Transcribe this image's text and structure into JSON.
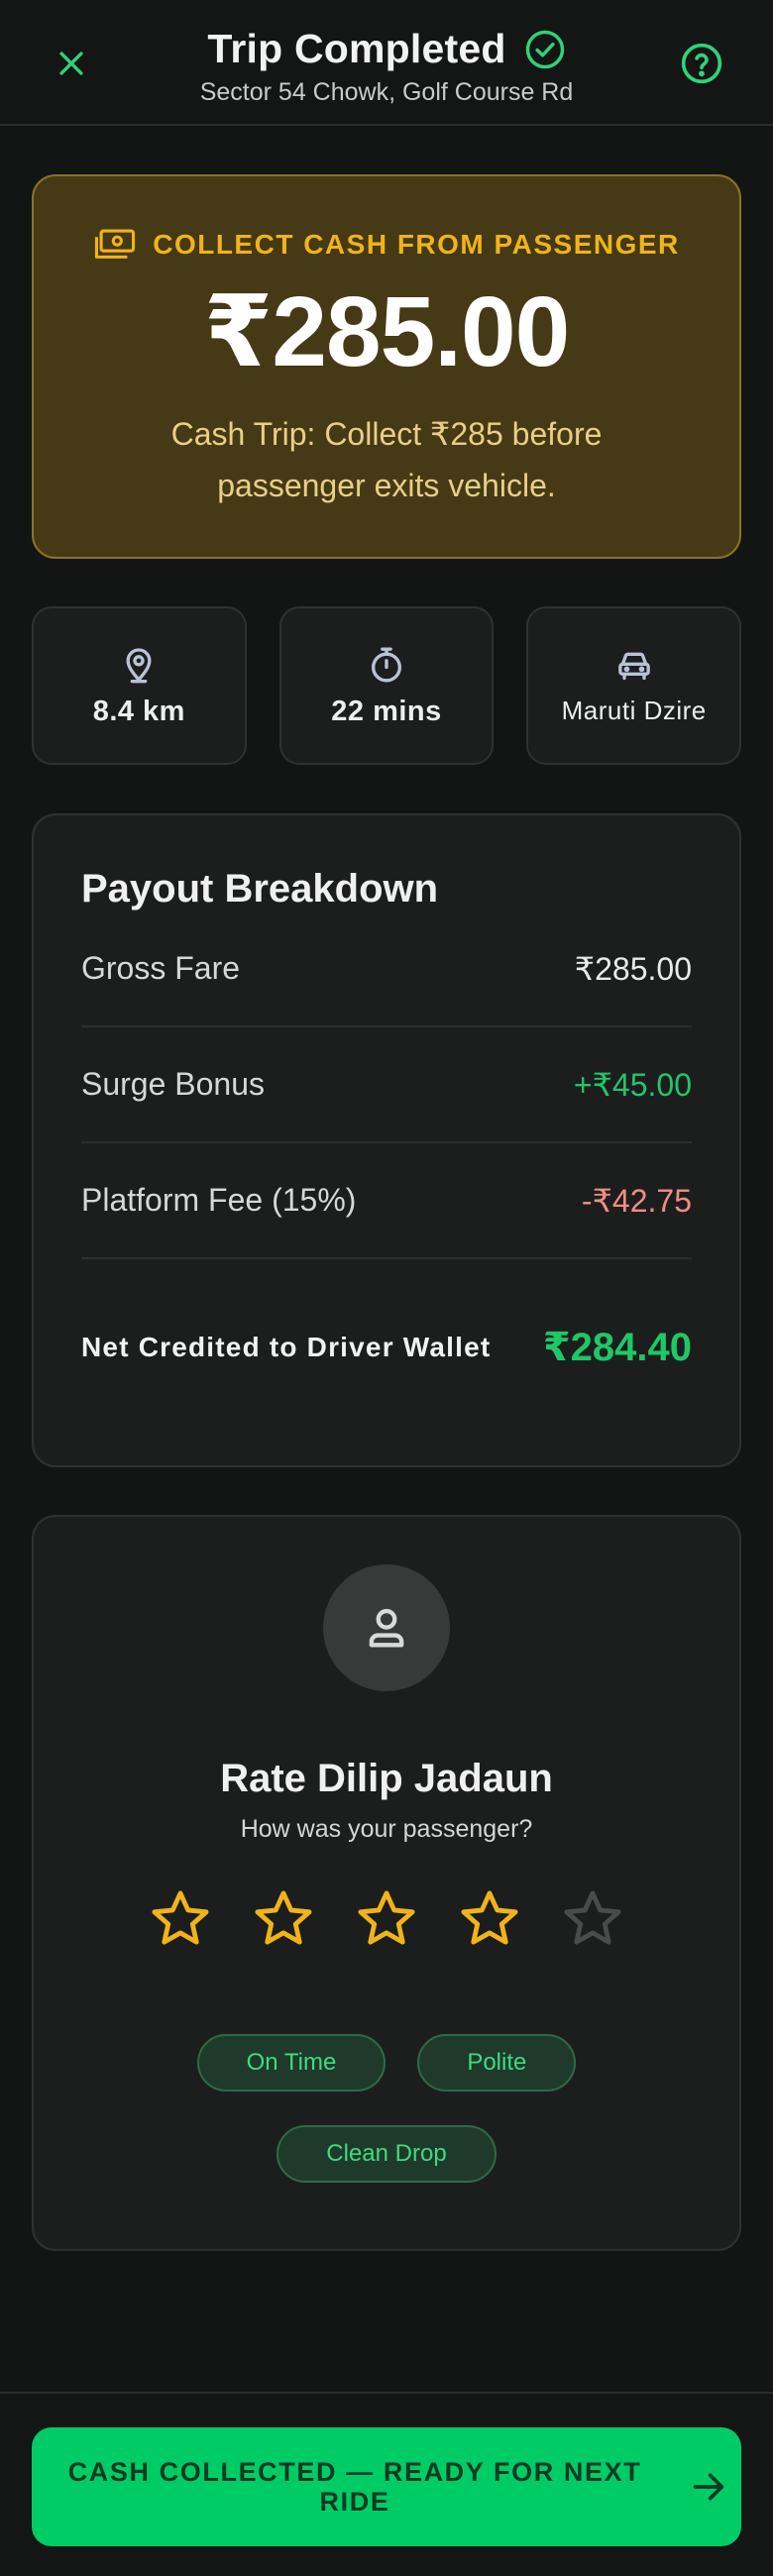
{
  "header": {
    "title": "Trip Completed",
    "subtitle": "Sector 54 Chowk, Golf Course Rd",
    "close_icon": "close-icon",
    "status_icon": "check-circle-icon",
    "help_icon": "help-circle-icon"
  },
  "cash_alert": {
    "icon": "cash-icon",
    "label": "COLLECT CASH FROM PASSENGER",
    "amount": "₹285.00",
    "note": "Cash Trip: Collect ₹285 before passenger exits vehicle."
  },
  "stats": [
    {
      "icon": "location-pin-icon",
      "value": "8.4 km"
    },
    {
      "icon": "timer-icon",
      "value": "22 mins"
    },
    {
      "icon": "car-icon",
      "value": "Maruti Dzire"
    }
  ],
  "payout": {
    "title": "Payout Breakdown",
    "rows": [
      {
        "label": "Gross Fare",
        "value": "₹285.00"
      },
      {
        "label": "Surge Bonus",
        "value": "+₹45.00"
      },
      {
        "label": "Platform Fee (15%)",
        "value": "-₹42.75"
      }
    ],
    "net_label": "Net Credited to Driver Wallet",
    "net_value": "₹284.40"
  },
  "rating": {
    "avatar_icon": "person-icon",
    "title": "Rate Dilip Jadaun",
    "subtitle": "How was your passenger?",
    "stars_selected": 4,
    "stars_total": 5,
    "tags": [
      "On Time",
      "Polite",
      "Clean Drop"
    ]
  },
  "footer": {
    "cta_label": "CASH COLLECTED — READY FOR NEXT RIDE",
    "cta_icon": "arrow-right-icon"
  },
  "colors": {
    "background": "#131414",
    "accent_green": "#00cc66",
    "cash_gold": "#f0b41a",
    "fee_red": "#f08e82"
  }
}
